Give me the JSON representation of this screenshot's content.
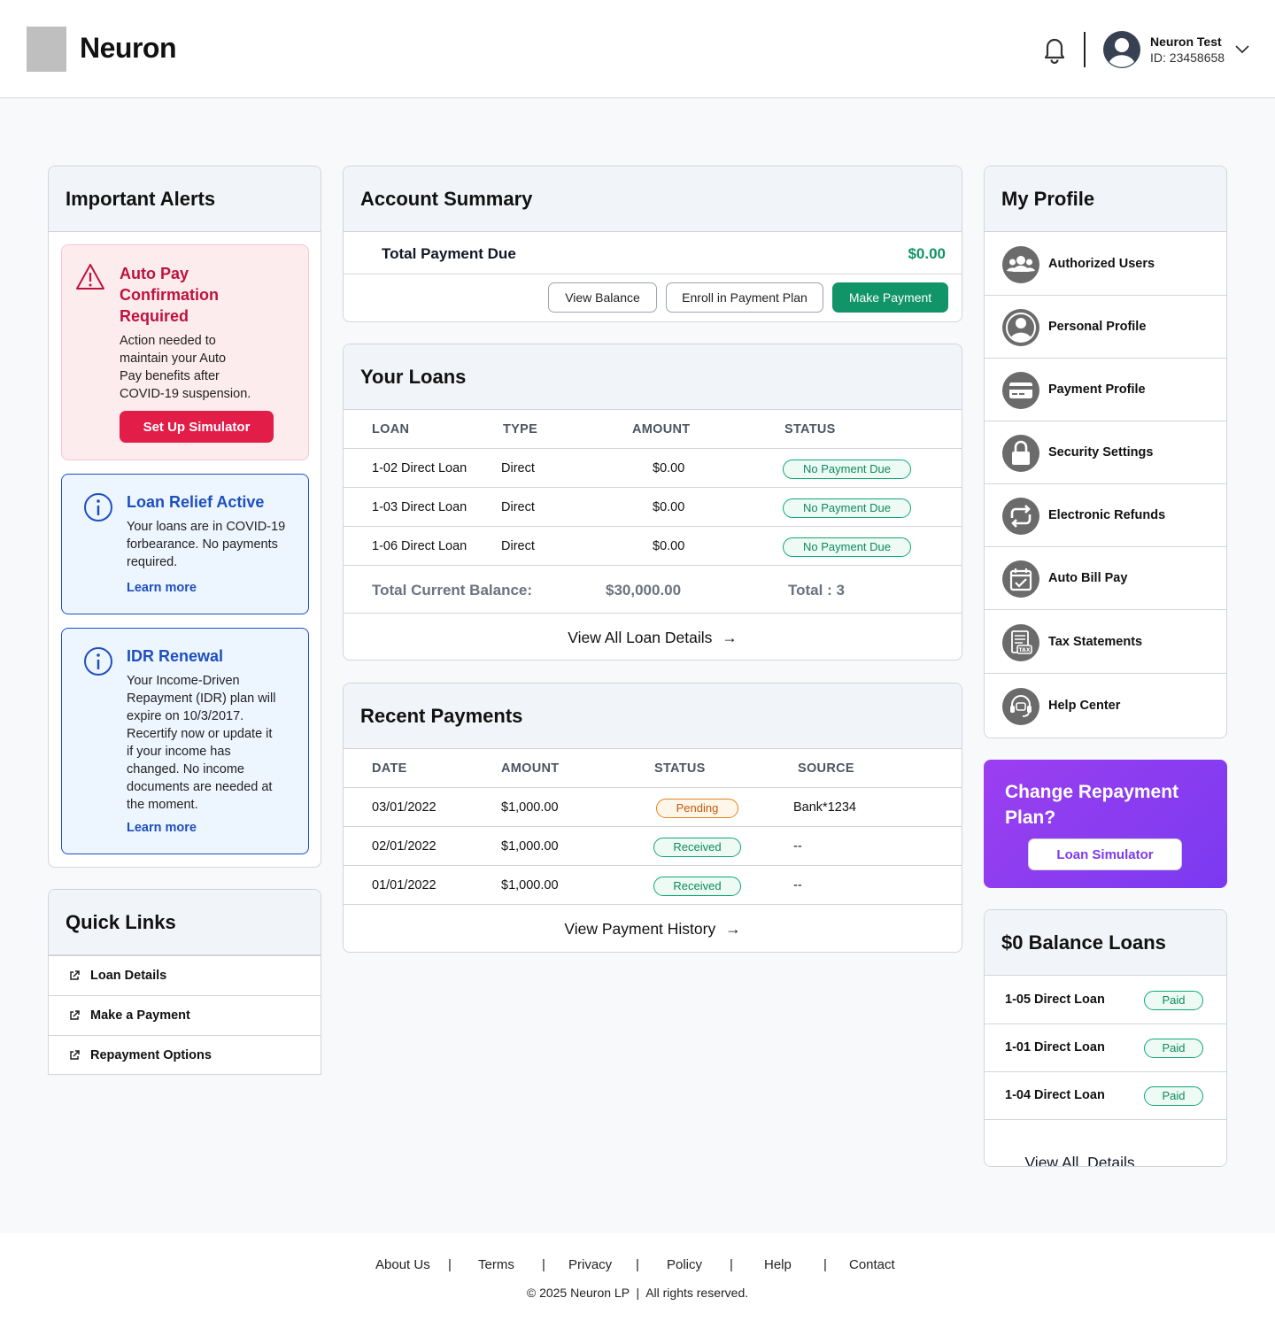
{
  "header": {
    "brand": "Neuron",
    "user_name": "Neuron Test",
    "user_id": "ID: 23458658"
  },
  "alerts": {
    "title": "Important Alerts",
    "autopay": {
      "title_l1": "Auto Pay",
      "title_l2": "Confirmation",
      "title_l3": "Required",
      "body_l1": "Action needed to",
      "body_l2": "maintain your Auto",
      "body_l3": "Pay benefits after",
      "body_l4": "COVID-19 suspension.",
      "button": "Set Up Simulator"
    },
    "relief": {
      "title": "Loan Relief Active",
      "body_l1": "Your loans are in COVID-19",
      "body_l2": "forbearance. No payments",
      "body_l3": "required.",
      "link": "Learn more"
    },
    "idr": {
      "title": "IDR Renewal",
      "body_l1": "Your Income-Driven",
      "body_l2": "Repayment (IDR) plan will",
      "body_l3": "expire on 10/3/2017.",
      "body_l4": "Recertify now or update it",
      "body_l5": "if your income has",
      "body_l6": "changed. No income",
      "body_l7": "documents are needed at",
      "body_l8": "the moment.",
      "link": "Learn more"
    }
  },
  "quick_links": {
    "title": "Quick Links",
    "items": [
      "Loan Details",
      "Make a Payment",
      "Repayment Options"
    ]
  },
  "account_summary": {
    "title": "Account Summary",
    "total_label": "Total Payment Due",
    "total_value": "$0.00",
    "buttons": {
      "view_balance": "View Balance",
      "enroll": "Enroll in Payment Plan",
      "make_payment": "Make Payment"
    }
  },
  "loans": {
    "title": "Your Loans",
    "columns": [
      "LOAN",
      "TYPE",
      "AMOUNT",
      "STATUS"
    ],
    "rows": [
      {
        "loan": "1-02 Direct Loan",
        "type": "Direct",
        "amount": "$0.00",
        "status": "No Payment Due"
      },
      {
        "loan": "1-03 Direct Loan",
        "type": "Direct",
        "amount": "$0.00",
        "status": "No Payment Due"
      },
      {
        "loan": "1-06 Direct Loan",
        "type": "Direct",
        "amount": "$0.00",
        "status": "No Payment Due"
      }
    ],
    "total_label": "Total Current Balance:",
    "total_value": "$30,000.00",
    "total_count": "Total : 3",
    "view_all": "View All Loan Details"
  },
  "payments": {
    "title": "Recent Payments",
    "columns": [
      "DATE",
      "AMOUNT",
      "STATUS",
      "SOURCE"
    ],
    "rows": [
      {
        "date": "03/01/2022",
        "amount": "$1,000.00",
        "status": "Pending",
        "source": "Bank*1234"
      },
      {
        "date": "02/01/2022",
        "amount": "$1,000.00",
        "status": "Received",
        "source": "--"
      },
      {
        "date": "01/01/2022",
        "amount": "$1,000.00",
        "status": "Received",
        "source": "--"
      }
    ],
    "view_all": "View Payment History"
  },
  "profile": {
    "title": "My Profile",
    "items": [
      {
        "label": "Authorized Users",
        "icon": "users-icon"
      },
      {
        "label": "Personal Profile",
        "icon": "person-icon"
      },
      {
        "label": "Payment Profile",
        "icon": "credit-card-icon"
      },
      {
        "label": "Security Settings",
        "icon": "lock-icon"
      },
      {
        "label": "Electronic Refunds",
        "icon": "refresh-icon"
      },
      {
        "label": "Auto Bill Pay",
        "icon": "calendar-check-icon"
      },
      {
        "label": "Tax Statements",
        "icon": "tax-document-icon"
      },
      {
        "label": "Help Center",
        "icon": "headset-icon"
      }
    ]
  },
  "promo": {
    "title": "Change Repayment Plan?",
    "button": "Loan Simulator"
  },
  "zero_balance": {
    "title": "$0 Balance Loans",
    "rows": [
      {
        "loan": "1-05 Direct Loan",
        "status": "Paid"
      },
      {
        "loan": "1-01 Direct Loan",
        "status": "Paid"
      },
      {
        "loan": "1-04 Direct Loan",
        "status": "Paid"
      }
    ],
    "view_all": "View All  Details"
  },
  "footer": {
    "links": [
      "About Us",
      "Terms",
      "Privacy",
      "Policy",
      "Help",
      "Contact"
    ],
    "separator": "|",
    "copyright": "© 2025 Neuron LP  |  All rights reserved."
  },
  "colors": {
    "accent_green": "#109468",
    "alert_red": "#e11d48",
    "info_blue": "#1e4fbf",
    "promo_purple": "#8b3df0"
  }
}
